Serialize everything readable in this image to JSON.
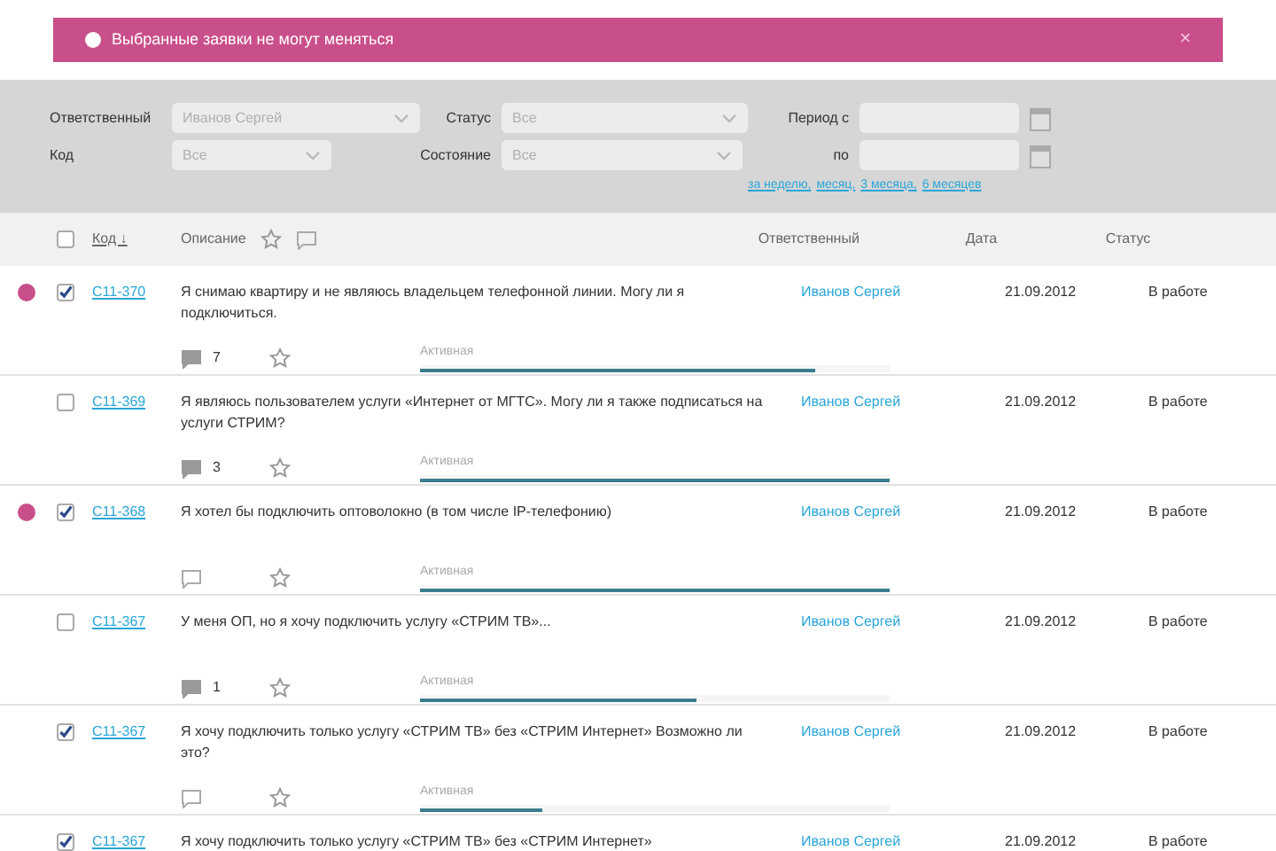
{
  "alert": {
    "text": "Выбранные заявки не могут меняться",
    "close": "×"
  },
  "filters": {
    "assignee": {
      "label": "Ответственный",
      "value": "Иванов Сергей"
    },
    "status": {
      "label": "Статус",
      "value": "Все"
    },
    "period_from": {
      "label": "Период с"
    },
    "code": {
      "label": "Код",
      "value": "Все"
    },
    "state": {
      "label": "Состояние",
      "value": "Все"
    },
    "period_to": {
      "label": "по"
    },
    "quick_periods": [
      "за неделю,",
      "месяц,",
      "3 месяца,",
      "6 месяцев"
    ]
  },
  "table": {
    "select_all": {
      "checked": false
    },
    "columns": [
      "Код ↓",
      "Описание",
      "Ответственный",
      "Дата",
      "Статус"
    ],
    "rows": [
      {
        "error": true,
        "checked": true,
        "code": "С11-370",
        "description": "Я снимаю квартиру и не являюсь владельцем телефонной линии. Могу ли я подключиться.",
        "assignee": "Иванов Сергей",
        "date": "21.09.2012",
        "status": "В работе",
        "comments": "7",
        "state": "Активная",
        "level": 0.84
      },
      {
        "error": false,
        "checked": false,
        "code": "С11-369",
        "description": "Я являюсь пользователем услуги «Интернет от МГТС». Могу ли я также подписаться на услуги СТРИМ?",
        "assignee": "Иванов Сергей",
        "date": "21.09.2012",
        "status": "В работе",
        "comments": "3",
        "state": "Активная",
        "level": 1.0
      },
      {
        "error": true,
        "checked": true,
        "code": "С11-368",
        "description": "Я хотел бы подключить оптоволокно (в том числе IP-телефонию)",
        "assignee": "Иванов Сергей",
        "date": "21.09.2012",
        "status": "В работе",
        "state": "Активная",
        "level": 1.0
      },
      {
        "error": false,
        "checked": false,
        "code": "С11-367",
        "description": "У меня ОП, но я хочу подключить услугу «СТРИМ ТВ»...",
        "assignee": "Иванов Сергей",
        "date": "21.09.2012",
        "status": "В работе",
        "comments": "1",
        "state": "Активная",
        "level": 0.59
      },
      {
        "error": false,
        "checked": true,
        "code": "С11-367",
        "description": "Я хочу подключить только услугу «СТРИМ ТВ» без «СТРИМ Интернет» Возможно ли это?",
        "assignee": "Иванов Сергей",
        "date": "21.09.2012",
        "status": "В работе",
        "state": "Активная",
        "level": 0.26
      },
      {
        "error": false,
        "checked": true,
        "code": "С11-367",
        "description": "Я хочу подключить только услугу «СТРИМ ТВ» без «СТРИМ Интернет»",
        "assignee": "Иванов Сергей",
        "date": "21.09.2012",
        "status": "В работе"
      }
    ]
  }
}
